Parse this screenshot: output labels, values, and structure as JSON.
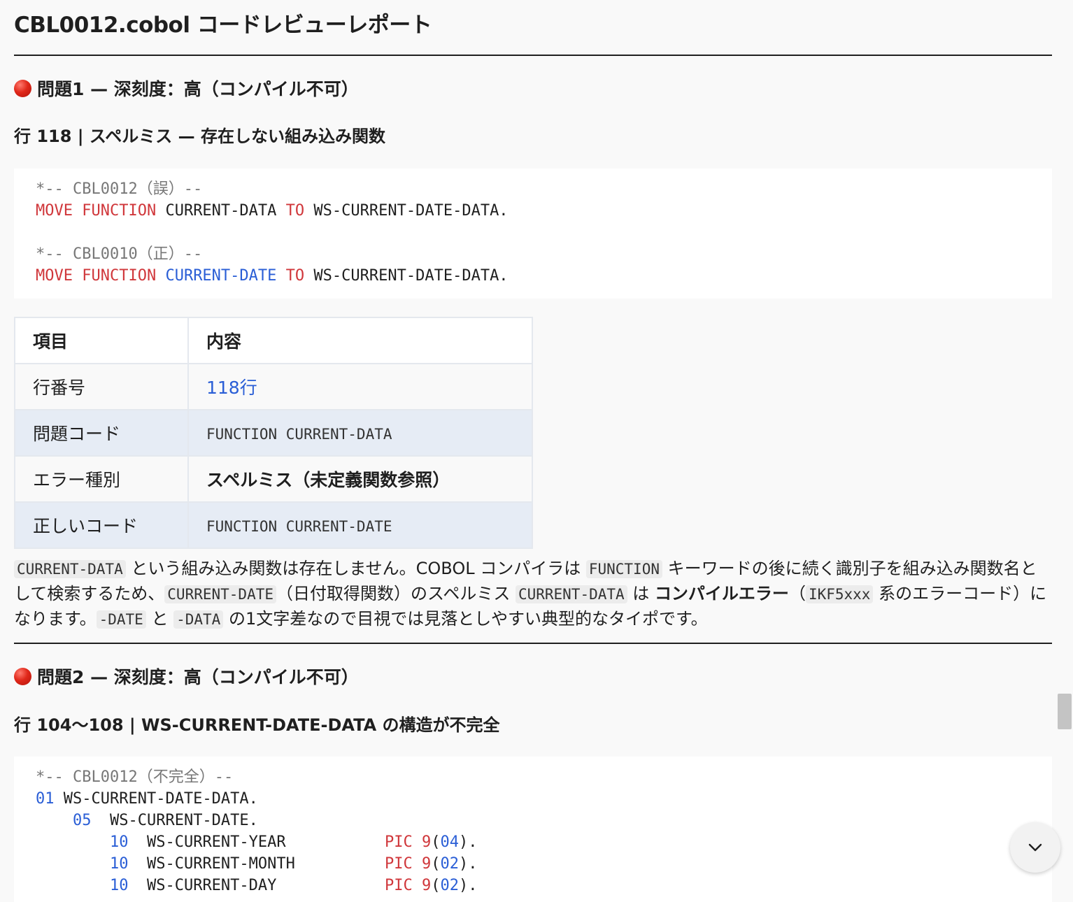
{
  "title": "CBL0012.cobol コードレビューレポート",
  "issue1": {
    "heading": "問題1 — 深刻度：高（コンパイル不可）",
    "subheading": "行 118 | スペルミス — 存在しない組み込み関数",
    "code": {
      "l1": "*-- CBL0012（誤）--",
      "l2_kw1": "MOVE",
      "l2_kw2": "FUNCTION",
      "l2_txt": "CURRENT-DATA",
      "l2_kw3": "TO",
      "l2_tail": "WS-CURRENT-DATE-DATA.",
      "l3": "*-- CBL0010（正）--",
      "l4_kw1": "MOVE",
      "l4_kw2": "FUNCTION",
      "l4_fn": "CURRENT-DATE",
      "l4_kw3": "TO",
      "l4_tail": "WS-CURRENT-DATE-DATA."
    },
    "table": {
      "headers": [
        "項目",
        "内容"
      ],
      "rows": [
        {
          "label": "行番号",
          "value": "118行"
        },
        {
          "label": "問題コード",
          "value": "FUNCTION CURRENT-DATA"
        },
        {
          "label": "エラー種別",
          "value": "スペルミス（未定義関数参照）"
        },
        {
          "label": "正しいコード",
          "value": "FUNCTION CURRENT-DATE"
        }
      ]
    },
    "paragraph": {
      "p1": "CURRENT-DATA",
      "t1": " という組み込み関数は存在しません。COBOL コンパイラは ",
      "p2": "FUNCTION",
      "t2": " キーワードの後に続く識別子を組み込み関数名として検索するため、",
      "p3": "CURRENT-DATE",
      "t3": "（日付取得関数）のスペルミス ",
      "p4": "CURRENT-DATA",
      "t4": " は ",
      "bold": "コンパイルエラー",
      "t5": "（",
      "p5": "IKF5xxx",
      "t6": " 系のエラーコード）になります。",
      "p6": "-DATE",
      "t7": " と ",
      "p7": "-DATA",
      "t8": " の1文字差なので目視では見落としやすい典型的なタイポです。"
    }
  },
  "issue2": {
    "heading": "問題2 — 深刻度：高（コンパイル不可）",
    "subheading": "行 104〜108 | WS-CURRENT-DATE-DATA の構造が不完全",
    "code": {
      "l1": "*-- CBL0012（不完全）--",
      "l2_num": "01",
      "l2_txt": "WS-CURRENT-DATE-DATA.",
      "l3_num": "05",
      "l3_txt": "WS-CURRENT-DATE.",
      "rows": [
        {
          "num": "10",
          "name": "WS-CURRENT-YEAR",
          "pic": "PIC",
          "nine": "9",
          "size": "04"
        },
        {
          "num": "10",
          "name": "WS-CURRENT-MONTH",
          "pic": "PIC",
          "nine": "9",
          "size": "02"
        },
        {
          "num": "10",
          "name": "WS-CURRENT-DAY",
          "pic": "PIC",
          "nine": "9",
          "size": "02"
        }
      ]
    }
  },
  "icons": {
    "danger": "red-circle-icon",
    "scroll_down": "chevron-down-icon"
  }
}
